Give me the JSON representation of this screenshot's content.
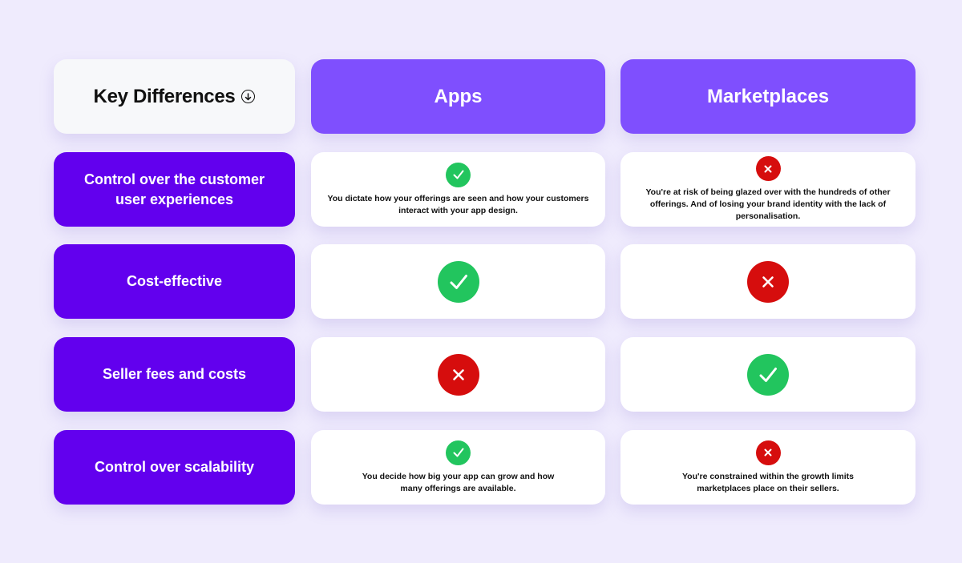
{
  "header": {
    "key_title": "Key Differences",
    "key_icon": "arrow-down-circle-icon",
    "columns": [
      "Apps",
      "Marketplaces"
    ]
  },
  "colors": {
    "background": "#efebfd",
    "header_purple": "#7f4ffe",
    "row_label_purple": "#6200ee",
    "check_green": "#22c55e",
    "cross_red": "#d60d0d"
  },
  "rows": [
    {
      "label": "Control over the customer user experiences",
      "apps": {
        "result": "check",
        "icon": "check-icon",
        "text": "You dictate how your offerings are seen and how your customers interact with your app design."
      },
      "marketplaces": {
        "result": "cross",
        "icon": "cross-icon",
        "text": "You're at risk of being glazed over with the hundreds of other offerings. And of losing your brand identity with the lack of personalisation."
      }
    },
    {
      "label": "Cost-effective",
      "apps": {
        "result": "check",
        "icon": "check-icon",
        "text": ""
      },
      "marketplaces": {
        "result": "cross",
        "icon": "cross-icon",
        "text": ""
      }
    },
    {
      "label": "Seller fees and costs",
      "apps": {
        "result": "cross",
        "icon": "cross-icon",
        "text": ""
      },
      "marketplaces": {
        "result": "check",
        "icon": "check-icon",
        "text": ""
      }
    },
    {
      "label": "Control over scalability",
      "apps": {
        "result": "check",
        "icon": "check-icon",
        "text": "You decide how big your app can grow and how many offerings are available."
      },
      "marketplaces": {
        "result": "cross",
        "icon": "cross-icon",
        "text": "You're constrained within the growth limits marketplaces place on their sellers."
      }
    }
  ]
}
